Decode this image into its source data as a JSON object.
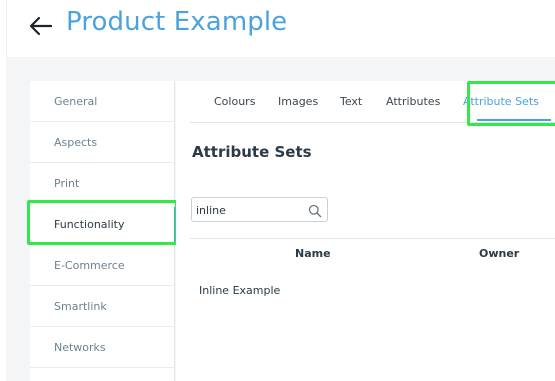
{
  "header": {
    "title": "Product Example",
    "back_icon": "arrow-left-icon",
    "title_color": "#4aa3df"
  },
  "sidebar": {
    "items": [
      {
        "label": "General"
      },
      {
        "label": "Aspects"
      },
      {
        "label": "Print"
      },
      {
        "label": "Functionality",
        "active": true
      },
      {
        "label": "E-Commerce"
      },
      {
        "label": "Smartlink"
      },
      {
        "label": "Networks"
      }
    ]
  },
  "tabs": {
    "items": [
      {
        "label": "Colours"
      },
      {
        "label": "Images"
      },
      {
        "label": "Text"
      },
      {
        "label": "Attributes"
      },
      {
        "label": "Attribute Sets",
        "active": true
      }
    ]
  },
  "main": {
    "section_title": "Attribute Sets",
    "search": {
      "value": "inline",
      "icon": "search-icon"
    },
    "table": {
      "columns": [
        "Name",
        "Owner"
      ],
      "rows": [
        {
          "name": "Inline Example",
          "owner": ""
        }
      ]
    }
  },
  "colors": {
    "accent": "#4aa3df",
    "highlight": "#35e84a",
    "background": "#f4f5f7"
  }
}
